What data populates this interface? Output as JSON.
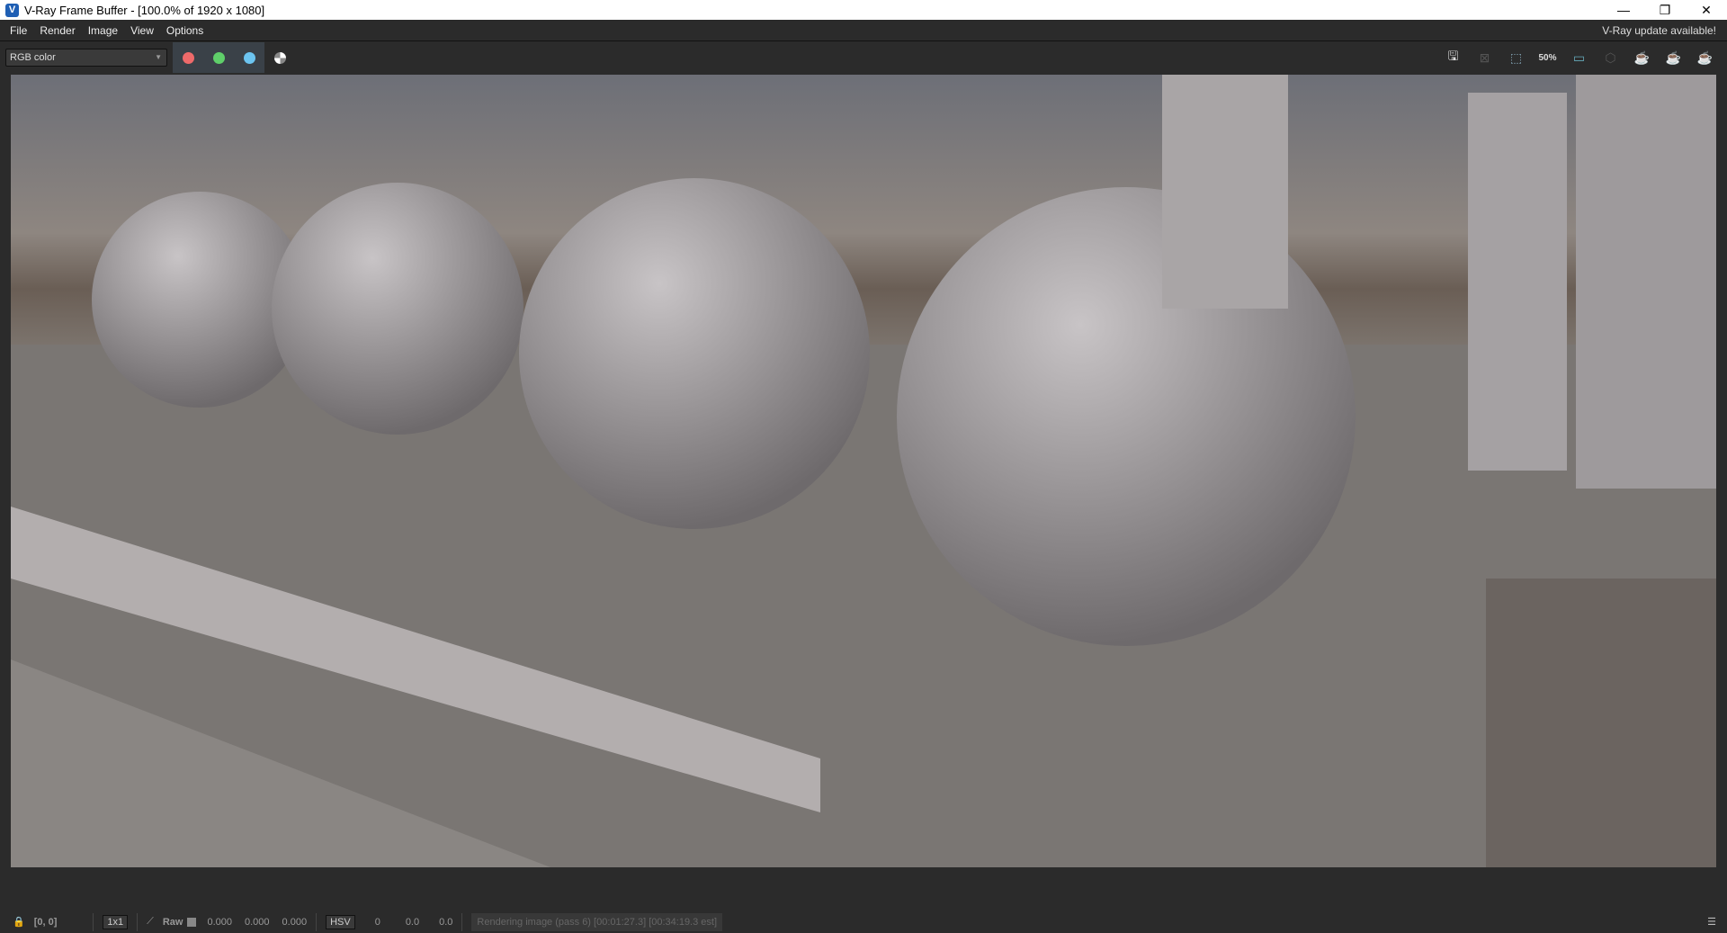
{
  "window": {
    "title": "V-Ray Frame Buffer - [100.0% of 1920 x 1080]",
    "controls": [
      "minimize",
      "restore",
      "close"
    ]
  },
  "menu": [
    "File",
    "Render",
    "Image",
    "View",
    "Options"
  ],
  "update_notice": "V-Ray update available!",
  "toolbar": {
    "channel_select": "RGB color",
    "channel_colors": {
      "red": "#ee6a6a",
      "green": "#5fcf6a",
      "blue": "#6cc4f0"
    },
    "zoom_label": "50%",
    "icons": [
      "save-icon",
      "clear-image-icon",
      "region-render-icon",
      "zoom-50-icon",
      "track-mouse-icon",
      "render-interactive-icon",
      "render-teapot-icon",
      "stop-render-icon",
      "render-teapot-2-icon"
    ]
  },
  "status": {
    "coords": "[0, 0]",
    "sample": "1x1",
    "raw_label": "Raw",
    "rgb": [
      "0.000",
      "0.000",
      "0.000"
    ],
    "color_mode": "HSV",
    "hsv": [
      "0",
      "0.0",
      "0.0"
    ],
    "progress_text": "Rendering image (pass 6) [00:01:27.3] [00:34:19.3 est]"
  }
}
